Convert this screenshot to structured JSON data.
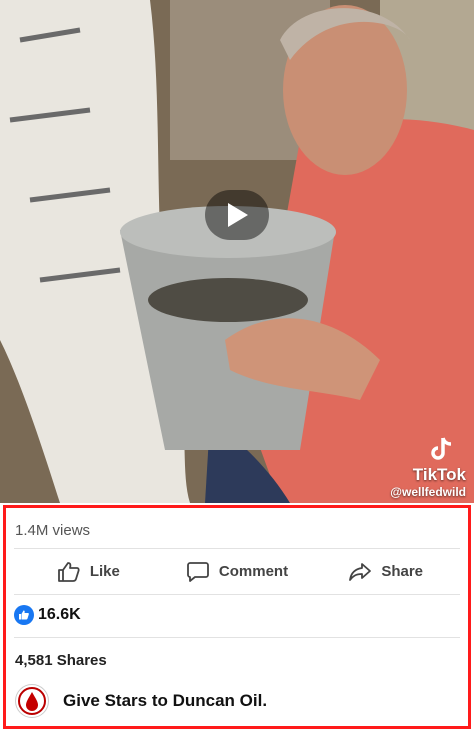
{
  "video": {
    "watermark_brand": "TikTok",
    "watermark_handle": "@wellfedwild"
  },
  "stats": {
    "views": "1.4M views",
    "reactions": "16.6K",
    "shares": "4,581 Shares"
  },
  "actions": {
    "like": "Like",
    "comment": "Comment",
    "share": "Share"
  },
  "page": {
    "cta": "Give Stars to Duncan Oil."
  },
  "colors": {
    "accent": "#1877f2",
    "highlight_border": "#ff1a1a"
  },
  "icons": [
    "play-icon",
    "tiktok-icon",
    "thumbs-up-icon",
    "comment-icon",
    "share-icon",
    "like-reaction-icon",
    "duncan-oil-logo"
  ]
}
